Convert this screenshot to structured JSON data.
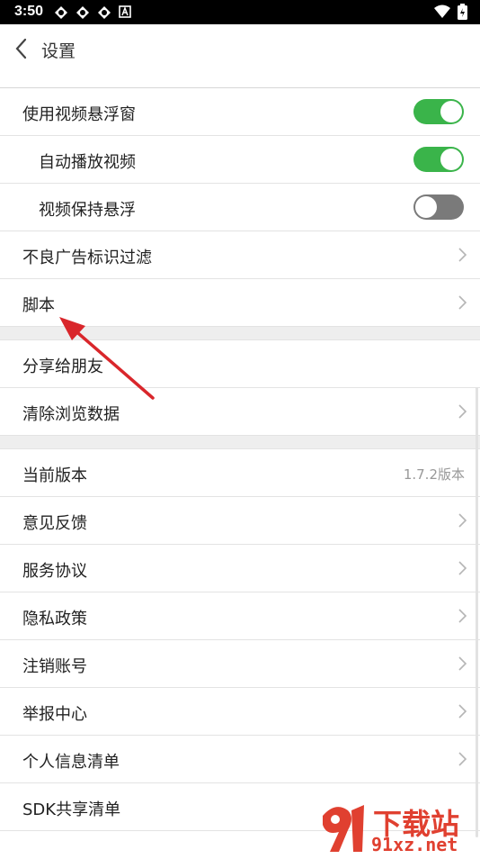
{
  "status_bar": {
    "time": "3:50"
  },
  "header": {
    "title": "设置"
  },
  "settings": {
    "floating_video": {
      "label": "使用视频悬浮窗",
      "enabled": true
    },
    "autoplay_video": {
      "label": "自动播放视频",
      "enabled": true
    },
    "keep_floating": {
      "label": "视频保持悬浮",
      "enabled": false
    },
    "ad_filter": {
      "label": "不良广告标识过滤"
    },
    "script": {
      "label": "脚本"
    },
    "share": {
      "label": "分享给朋友"
    },
    "clear_data": {
      "label": "清除浏览数据"
    },
    "version": {
      "label": "当前版本",
      "value": "1.7.2版本"
    },
    "feedback": {
      "label": "意见反馈"
    },
    "service_agreement": {
      "label": "服务协议"
    },
    "privacy_policy": {
      "label": "隐私政策"
    },
    "cancel_account": {
      "label": "注销账号"
    },
    "report_center": {
      "label": "举报中心"
    },
    "personal_info_list": {
      "label": "个人信息清单"
    },
    "sdk_share_list": {
      "label": "SDK共享清单"
    }
  },
  "colors": {
    "toggle_on": "#3ab44a",
    "toggle_off": "#7a7a7a",
    "arrow": "#d9262b"
  },
  "watermark": {
    "cn": "下载站",
    "domain": "91xz.net"
  }
}
